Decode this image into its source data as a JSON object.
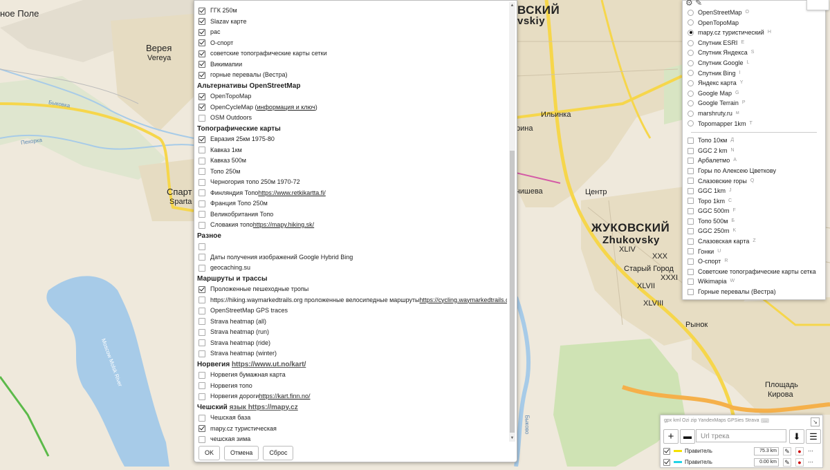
{
  "map_labels": {
    "nope_pole": "ное Поле",
    "vereya_ru": "Верея",
    "vereya_en": "Vereya",
    "sparta_ru": "Спарт",
    "sparta_en": "Sparta",
    "bykovka": "Быковка",
    "pekorka": "Пехорка",
    "moskva_river": "Moscow Molsk River",
    "zhukovsky_top_ru": "ВСКИЙ",
    "zhukovsky_top_en": "vskiy",
    "ilinka": "Ильинка",
    "rina": "рина",
    "tsentr": "Центр",
    "chisheva": "чишева",
    "zhukovsky_ru": "ЖУКОВСКИЙ",
    "zhukovsky_en": "Zhukovsky",
    "xliv": "XLIV",
    "xxx": "XXX",
    "stary_gorod": "Старый Город",
    "xxxi": "XXXI",
    "xlvii": "XLVII",
    "xlviii": "XLVIII",
    "rynok": "Рынок",
    "ploshchad": "Площадь",
    "kirova": "Кирова",
    "bykovo": "Быково"
  },
  "dialog": {
    "rows": [
      {
        "type": "item",
        "checked": true,
        "label": "ГГК 250м"
      },
      {
        "type": "item",
        "checked": true,
        "label": "Slazav карте"
      },
      {
        "type": "item",
        "checked": true,
        "label": "рас"
      },
      {
        "type": "item",
        "checked": true,
        "label": "О-спорт"
      },
      {
        "type": "item",
        "checked": true,
        "label": "советские топографические карты сетки"
      },
      {
        "type": "item",
        "checked": true,
        "label": "Викимапии"
      },
      {
        "type": "item",
        "checked": true,
        "label": "горные перевалы (Вестра)"
      },
      {
        "type": "section",
        "label": "Альтернативы OpenStreetMap"
      },
      {
        "type": "item",
        "checked": true,
        "label": "OpenТороMap"
      },
      {
        "type": "item",
        "checked": true,
        "label": "OpenCycleMap (",
        "link": "информация и ключ",
        "after": ")"
      },
      {
        "type": "item",
        "checked": false,
        "label": "OSM Outdoors"
      },
      {
        "type": "section",
        "label": "Топографические карты"
      },
      {
        "type": "item",
        "checked": true,
        "label": "Евразия 25км 1975-80"
      },
      {
        "type": "item",
        "checked": false,
        "label": "Кавказ 1км"
      },
      {
        "type": "item",
        "checked": false,
        "label": "Кавказ 500м"
      },
      {
        "type": "item",
        "checked": false,
        "label": "Топо 250м"
      },
      {
        "type": "item",
        "checked": false,
        "label": "Черногория топо 250м 1970-72"
      },
      {
        "type": "item",
        "checked": false,
        "label": "Финляндия Топо ",
        "link": "https://www.retkikartta.fi/"
      },
      {
        "type": "item",
        "checked": false,
        "label": "Франция Топо 250м"
      },
      {
        "type": "item",
        "checked": false,
        "label": "Великобритания Топо"
      },
      {
        "type": "item",
        "checked": false,
        "label": "Словакия топо ",
        "link": "https://mapy.hiking.sk/"
      },
      {
        "type": "section",
        "label": "Разное"
      },
      {
        "type": "item",
        "checked": false,
        "label": ""
      },
      {
        "type": "item",
        "checked": false,
        "label": "Даты получения изображений Google Hybrid Bing"
      },
      {
        "type": "item",
        "checked": false,
        "label": "geocaching.su"
      },
      {
        "type": "section",
        "label": "Маршруты и трассы"
      },
      {
        "type": "item",
        "checked": true,
        "label": "Проложенные пешеходные тропы"
      },
      {
        "type": "item",
        "checked": false,
        "label": "https://hiking.waymarkedtrails.org проложенные велосипедные маршруты ",
        "link": "https://cycling.waymarkedtrails.org"
      },
      {
        "type": "item",
        "checked": false,
        "label": "OpenStreetMap GPS traces"
      },
      {
        "type": "item",
        "checked": false,
        "label": "Strava heatmap (all)"
      },
      {
        "type": "item",
        "checked": false,
        "label": "Strava heatmap (run)"
      },
      {
        "type": "item",
        "checked": false,
        "label": "Strava heatmap (ride)"
      },
      {
        "type": "item",
        "checked": false,
        "label": "Strava heatmap (winter)"
      },
      {
        "type": "section",
        "label": "Норвегия ",
        "link": "https://www.ut.no/kart/"
      },
      {
        "type": "item",
        "checked": false,
        "label": "Норвегия бумажная карта"
      },
      {
        "type": "item",
        "checked": false,
        "label": "Норвегия топо"
      },
      {
        "type": "item",
        "checked": false,
        "label": "Норвегия дороги ",
        "link": "https://kart.finn.no/"
      },
      {
        "type": "section",
        "label": "Чешский ",
        "link": "язык https://mapy.cz"
      },
      {
        "type": "item",
        "checked": false,
        "label": "Чешская база"
      },
      {
        "type": "item",
        "checked": true,
        "label": "mapy.cz туристическая"
      },
      {
        "type": "item",
        "checked": false,
        "label": "чешская зима"
      }
    ],
    "ok_label": "OK",
    "cancel_label": "Отмена",
    "reset_label": "Сброс"
  },
  "layers_panel": {
    "base": [
      {
        "label": "OpenStreetMap",
        "key": "O",
        "selected": false
      },
      {
        "label": "OpenTopoMap",
        "key": "",
        "selected": false
      },
      {
        "label": "mapy.cz туристический",
        "key": "H",
        "selected": true
      },
      {
        "label": "Спутник ESRI",
        "key": "E",
        "selected": false
      },
      {
        "label": "Спутник Яндекса",
        "key": "S",
        "selected": false
      },
      {
        "label": "Спутник Google",
        "key": "L",
        "selected": false
      },
      {
        "label": "Спутник Bing",
        "key": "I",
        "selected": false
      },
      {
        "label": "Яндекс карта",
        "key": "Y",
        "selected": false
      },
      {
        "label": "Google Map",
        "key": "G",
        "selected": false
      },
      {
        "label": "Google Terrain",
        "key": "P",
        "selected": false
      },
      {
        "label": "marshruty.ru",
        "key": "м",
        "selected": false
      },
      {
        "label": "Topomapper 1km",
        "key": "T",
        "selected": false
      }
    ],
    "overlays": [
      {
        "label": "Топо 10км",
        "key": "Д"
      },
      {
        "label": "GGC 2 km",
        "key": "N"
      },
      {
        "label": "Арбалетмо",
        "key": "A"
      },
      {
        "label": "Горы по Алексею Цветкову",
        "key": ""
      },
      {
        "label": "Слазовские горы",
        "key": "Q"
      },
      {
        "label": "GGC 1km",
        "key": "J"
      },
      {
        "label": "Topo 1km",
        "key": "C"
      },
      {
        "label": "GGC 500m",
        "key": "F"
      },
      {
        "label": "Топо 500м",
        "key": "Б"
      },
      {
        "label": "GGC 250m",
        "key": "K"
      },
      {
        "label": "Слазовская карта",
        "key": "Z"
      },
      {
        "label": "Гонки",
        "key": "U"
      },
      {
        "label": "О-спорт",
        "key": "R"
      },
      {
        "label": "Советские топографические карты сетка",
        "key": ""
      },
      {
        "label": "Wikimapia",
        "key": "W"
      },
      {
        "label": "Горные перевалы (Вестра)",
        "key": ""
      }
    ]
  },
  "track_panel": {
    "formats": "gpx kml Ozi zip YandexMaps GPSies Strava",
    "more": "...",
    "url_placeholder": "Url трека",
    "tracks": [
      {
        "name": "Правитель",
        "km": "75.3 km",
        "color": "#f5e100"
      },
      {
        "name": "Правитель",
        "km": "0.00 km",
        "color": "#22d3e6"
      }
    ]
  },
  "colors": {
    "map_bg": "#efe9dc",
    "water": "#a7cbe8",
    "city": "#e7ddc3",
    "green": "#cfe3b4",
    "road_major": "#f6d64b",
    "road_orange": "#f5b04a"
  }
}
